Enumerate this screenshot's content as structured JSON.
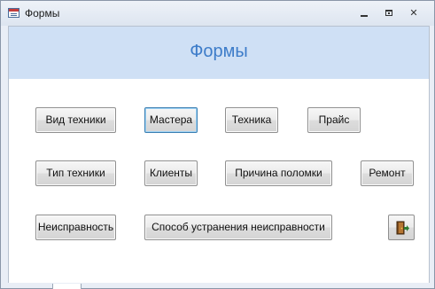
{
  "window": {
    "title": "Формы"
  },
  "header": {
    "title": "Формы"
  },
  "buttons": {
    "vid_tekhniki": "Вид техники",
    "mastera": "Мастера",
    "tekhnika": "Техника",
    "prais": "Прайс",
    "tip_tekhniki": "Тип техники",
    "klienty": "Клиенты",
    "prichina_polomki": "Причина поломки",
    "remont": "Ремонт",
    "neispravnost": "Неисправность",
    "sposob_ustraneniya": "Способ устранения неисправности"
  },
  "icons": {
    "app": "form-window-icon",
    "exit": "exit-door-icon"
  },
  "colors": {
    "header_band": "#cfe0f5",
    "header_title": "#3d7cc9",
    "focus_border": "#3c7fb1"
  }
}
